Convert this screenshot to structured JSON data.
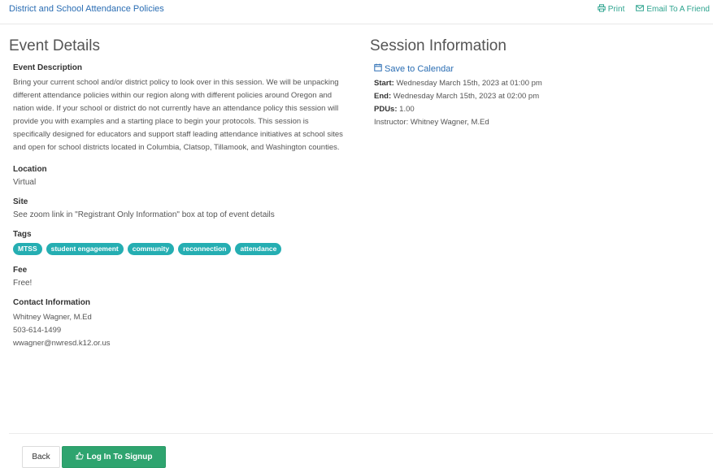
{
  "header": {
    "title": "District and School Attendance Policies",
    "print_label": "Print",
    "email_label": "Email To A Friend"
  },
  "event": {
    "heading": "Event Details",
    "description_label": "Event Description",
    "description": "Bring your current school and/or district policy to look over in this session. We will be unpacking different attendance policies within our region along with different policies around Oregon and nation wide. If your school or district do not currently have an attendance policy this session will provide you with examples and a starting place to begin your protocols. This session is specifically designed for educators and support staff leading attendance initiatives at school sites and open for school districts located in Columbia, Clatsop, Tillamook, and Washington counties.",
    "location_label": "Location",
    "location": "Virtual",
    "site_label": "Site",
    "site": "See zoom link in \"Registrant Only Information\" box at top of event details",
    "tags_label": "Tags",
    "tags": [
      "MTSS",
      "student engagement",
      "community",
      "reconnection",
      "attendance"
    ],
    "fee_label": "Fee",
    "fee": "Free!",
    "contact_label": "Contact Information",
    "contact_name": "Whitney Wagner, M.Ed",
    "contact_phone": "503-614-1499",
    "contact_email": "wwagner@nwresd.k12.or.us"
  },
  "session": {
    "heading": "Session Information",
    "save_label": "Save to Calendar",
    "start_label": "Start:",
    "start_value": "Wednesday March 15th, 2023 at 01:00 pm",
    "end_label": "End:",
    "end_value": "Wednesday March 15th, 2023 at 02:00 pm",
    "pdu_label": "PDUs:",
    "pdu_value": "1.00",
    "instructor": "Instructor: Whitney Wagner, M.Ed"
  },
  "actions": {
    "back_label": "Back",
    "login_label": "Log In To Signup"
  },
  "colors": {
    "link": "#2a6db3",
    "accent": "#2ea48f",
    "tag": "#25aeb2",
    "button_green": "#2ea46f"
  },
  "icons": [
    "print-icon",
    "envelope-icon",
    "calendar-icon",
    "thumbs-up-icon"
  ]
}
